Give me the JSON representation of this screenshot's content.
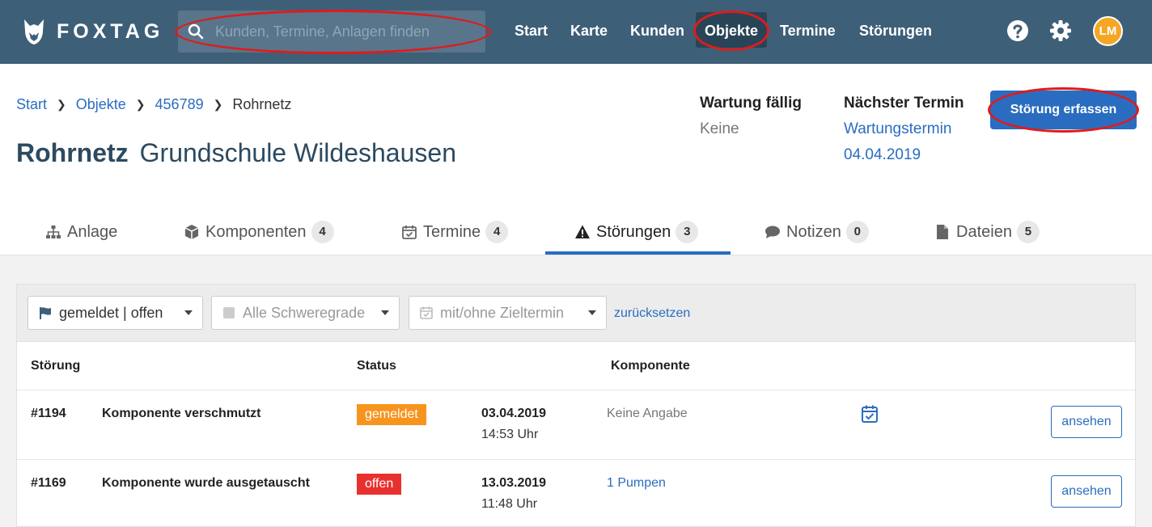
{
  "app": {
    "logo_text": "FOXTAG"
  },
  "search": {
    "placeholder": "Kunden, Termine, Anlagen finden"
  },
  "nav": {
    "items": [
      {
        "label": "Start"
      },
      {
        "label": "Karte"
      },
      {
        "label": "Kunden"
      },
      {
        "label": "Objekte",
        "active": true
      },
      {
        "label": "Termine"
      },
      {
        "label": "Störungen"
      }
    ],
    "user_initials": "LM"
  },
  "breadcrumb": {
    "items": [
      "Start",
      "Objekte",
      "456789"
    ],
    "current": "Rohrnetz"
  },
  "page": {
    "title": "Rohrnetz",
    "subtitle": "Grundschule Wildeshausen"
  },
  "info": {
    "maintenance_label": "Wartung fällig",
    "maintenance_value": "Keine",
    "next_label": "Nächster Termin",
    "next_type": "Wartungstermin",
    "next_date": "04.04.2019"
  },
  "actions": {
    "create_fault": "Störung erfassen"
  },
  "tabs": [
    {
      "label": "Anlage",
      "icon": "sitemap-icon"
    },
    {
      "label": "Komponenten",
      "count": "4",
      "icon": "cube-icon"
    },
    {
      "label": "Termine",
      "count": "4",
      "icon": "calendar-check-icon"
    },
    {
      "label": "Störungen",
      "count": "3",
      "icon": "warning-icon",
      "active": true
    },
    {
      "label": "Notizen",
      "count": "0",
      "icon": "comment-icon"
    },
    {
      "label": "Dateien",
      "count": "5",
      "icon": "file-icon"
    }
  ],
  "filters": {
    "status": "gemeldet | offen",
    "severity": "Alle Schweregrade",
    "deadline": "mit/ohne Zieltermin",
    "reset": "zurücksetzen"
  },
  "table": {
    "headers": {
      "fault": "Störung",
      "status": "Status",
      "component": "Komponente"
    },
    "rows": [
      {
        "id": "#1194",
        "title": "Komponente verschmutzt",
        "status": "gemeldet",
        "status_color": "#f7941d",
        "date": "03.04.2019",
        "time": "14:53 Uhr",
        "component": "Keine Angabe",
        "component_link": false,
        "has_deadline_icon": true,
        "action": "ansehen"
      },
      {
        "id": "#1169",
        "title": "Komponente wurde ausgetauscht",
        "status": "offen",
        "status_color": "#e8312f",
        "date": "13.03.2019",
        "time": "11:48 Uhr",
        "component": "1 Pumpen",
        "component_link": true,
        "has_deadline_icon": false,
        "action": "ansehen"
      }
    ]
  },
  "colors": {
    "topbar": "#3e5f78",
    "accent": "#2a6dc0",
    "highlight": "#e01b1b"
  }
}
